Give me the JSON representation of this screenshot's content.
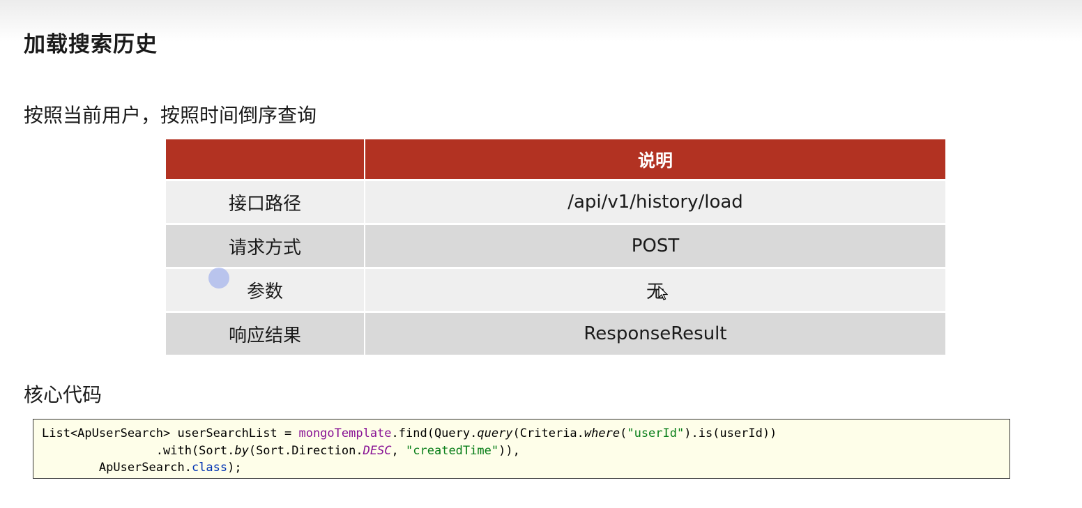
{
  "heading": "加载搜索历史",
  "description": "按照当前用户，按照时间倒序查询",
  "table": {
    "header": [
      "",
      "说明"
    ],
    "rows": [
      {
        "label": "接口路径",
        "value": "/api/v1/history/load"
      },
      {
        "label": "请求方式",
        "value": "POST"
      },
      {
        "label": "参数",
        "value": "无"
      },
      {
        "label": "响应结果",
        "value": "ResponseResult"
      }
    ]
  },
  "code_section_title": "核心代码",
  "code": {
    "l1": {
      "a": "List<ApUserSearch> userSearchList = ",
      "b": "mongoTemplate",
      "c": ".find(Query.",
      "d": "query",
      "e": "(Criteria.",
      "f": "where",
      "g": "(",
      "h": "\"userId\"",
      "i": ").is(userId))"
    },
    "l2": {
      "a": "                .with(Sort.",
      "b": "by",
      "c": "(Sort.Direction.",
      "d": "DESC",
      "e": ", ",
      "f": "\"createdTime\"",
      "g": ")),"
    },
    "l3": {
      "a": "        ApUserSearch.",
      "b": "class",
      "c": ");"
    }
  },
  "colors": {
    "header_bg": "#b23222",
    "code_bg": "#fefee9"
  }
}
